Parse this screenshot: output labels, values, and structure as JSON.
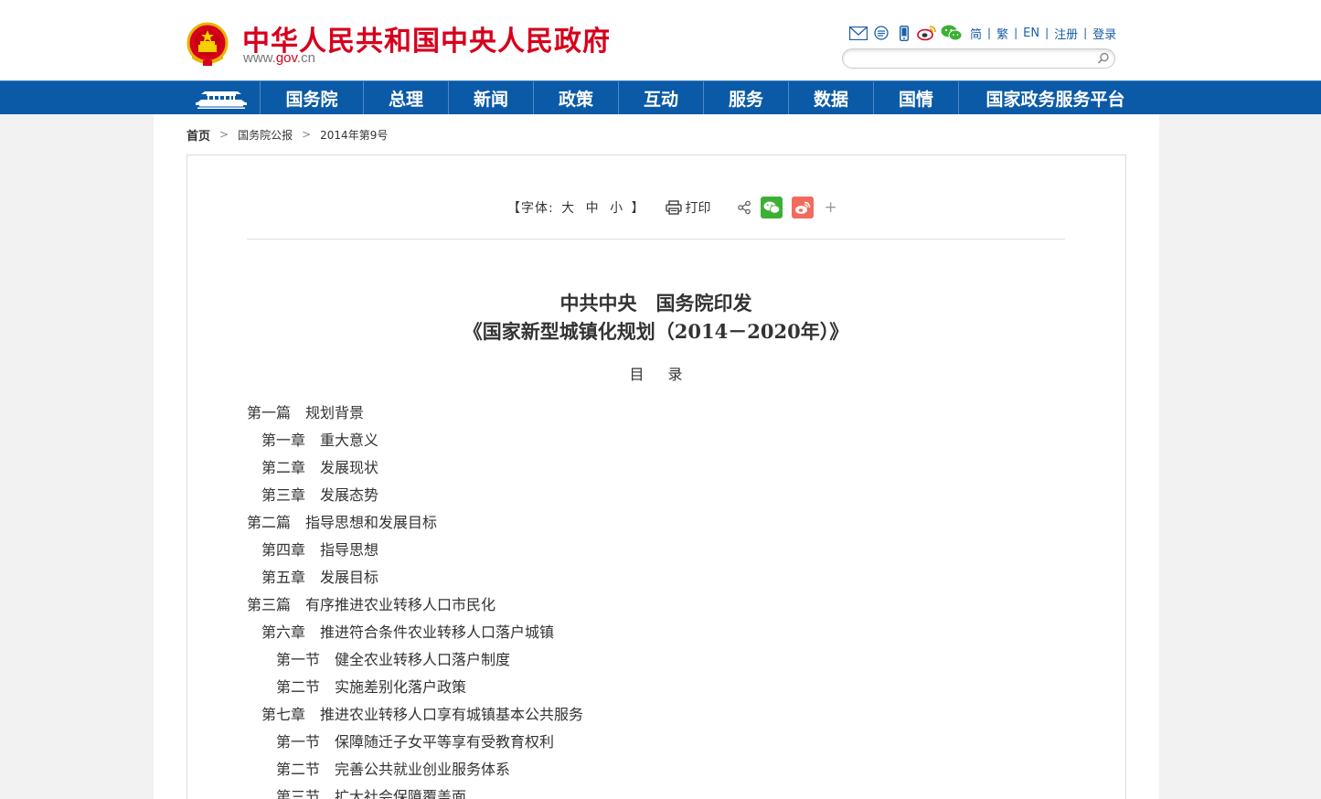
{
  "header": {
    "site_title": "中华人民共和国中央人民政府",
    "domain_prefix": "www.",
    "domain_brand": "gov",
    "domain_suffix": ".cn",
    "toolbar_links": [
      "简",
      "繁",
      "EN",
      "注册",
      "登录"
    ],
    "toolbar_icons": [
      "mail-icon",
      "rss-icon",
      "mobile-icon",
      "weibo-icon",
      "wechat-icon"
    ],
    "search": {
      "placeholder": "",
      "value": ""
    }
  },
  "nav": {
    "items": [
      "国务院",
      "总理",
      "新闻",
      "政策",
      "互动",
      "服务",
      "数据",
      "国情",
      "国家政务服务平台"
    ]
  },
  "breadcrumb": {
    "home": "首页",
    "section": "国务院公报",
    "issue": "2014年第9号"
  },
  "article_tools": {
    "font_size_open": "【字体:",
    "font_large": "大",
    "font_medium": "中",
    "font_small": "小",
    "font_size_close": "】",
    "print_label": "打印",
    "more": "+"
  },
  "document": {
    "title_line1": "中共中央　国务院印发",
    "title_line2": "《国家新型城镇化规划（2014－2020年）》",
    "toc_heading": "目录",
    "toc": [
      {
        "level": 1,
        "num": "第一篇",
        "text": "规划背景"
      },
      {
        "level": 2,
        "num": "第一章",
        "text": "重大意义"
      },
      {
        "level": 2,
        "num": "第二章",
        "text": "发展现状"
      },
      {
        "level": 2,
        "num": "第三章",
        "text": "发展态势"
      },
      {
        "level": 1,
        "num": "第二篇",
        "text": "指导思想和发展目标"
      },
      {
        "level": 2,
        "num": "第四章",
        "text": "指导思想"
      },
      {
        "level": 2,
        "num": "第五章",
        "text": "发展目标"
      },
      {
        "level": 1,
        "num": "第三篇",
        "text": "有序推进农业转移人口市民化"
      },
      {
        "level": 2,
        "num": "第六章",
        "text": "推进符合条件农业转移人口落户城镇"
      },
      {
        "level": 3,
        "num": "第一节",
        "text": "健全农业转移人口落户制度"
      },
      {
        "level": 3,
        "num": "第二节",
        "text": "实施差别化落户政策"
      },
      {
        "level": 2,
        "num": "第七章",
        "text": "推进农业转移人口享有城镇基本公共服务"
      },
      {
        "level": 3,
        "num": "第一节",
        "text": "保障随迁子女平等享有受教育权利"
      },
      {
        "level": 3,
        "num": "第二节",
        "text": "完善公共就业创业服务体系"
      },
      {
        "level": 3,
        "num": "第三节",
        "text": "扩大社会保障覆盖面"
      }
    ]
  },
  "colors": {
    "brand_red": "#d7001c",
    "nav_blue": "#0b5aa7",
    "link_blue": "#1a5fa9"
  }
}
